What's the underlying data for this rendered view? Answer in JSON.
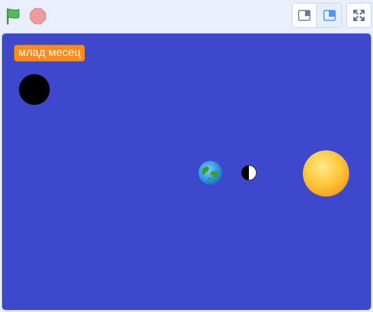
{
  "toolbar": {
    "green_flag_icon": "green-flag-icon",
    "stop_icon": "stop-icon",
    "small_stage_icon": "small-stage-icon",
    "large_stage_icon": "large-stage-icon",
    "fullscreen_icon": "fullscreen-icon"
  },
  "stage": {
    "variable_label": "млад месец",
    "sprites": [
      "black-moon",
      "earth",
      "half-moon",
      "sun"
    ]
  },
  "colors": {
    "stage_background": "#3d48cc",
    "monitor": "#ff8c1a",
    "flag": "#4cbf56",
    "stop": "#ec9c9c",
    "accent": "#4c97ff"
  }
}
